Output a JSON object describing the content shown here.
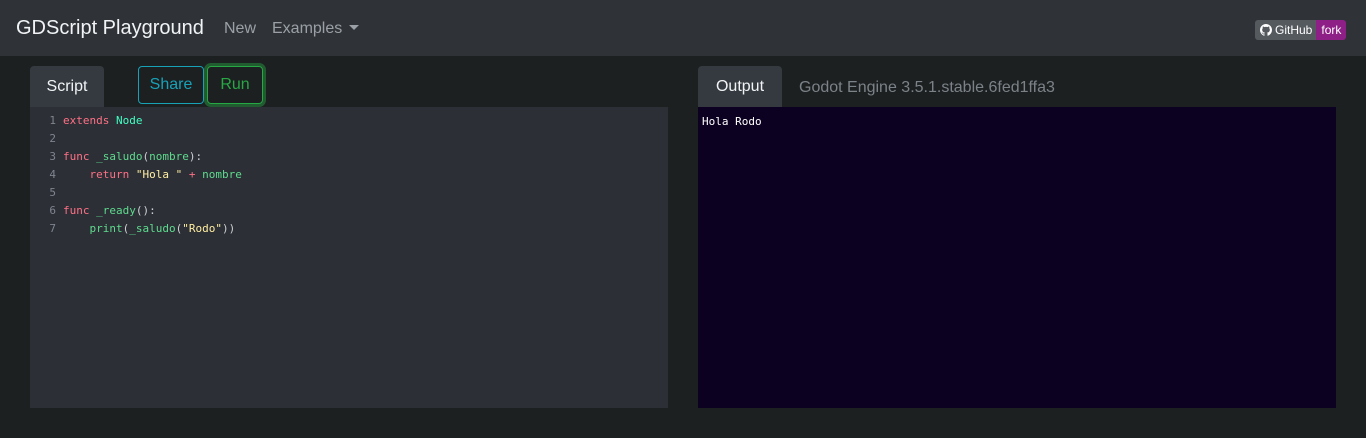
{
  "navbar": {
    "brand": "GDScript Playground",
    "new_label": "New",
    "examples_label": "Examples",
    "github_label": "GitHub",
    "fork_label": "fork",
    "fork_color": "#8e1f86"
  },
  "script_panel": {
    "tab_label": "Script",
    "share_label": "Share",
    "run_label": "Run",
    "lines": [
      {
        "num": "1",
        "tokens": [
          {
            "t": "extends",
            "c": "kw"
          },
          {
            "t": " ",
            "c": "pl"
          },
          {
            "t": "Node",
            "c": "cls"
          }
        ]
      },
      {
        "num": "2",
        "tokens": []
      },
      {
        "num": "3",
        "tokens": [
          {
            "t": "func",
            "c": "kw"
          },
          {
            "t": " ",
            "c": "pl"
          },
          {
            "t": "_saludo",
            "c": "fn2"
          },
          {
            "t": "(",
            "c": "pl"
          },
          {
            "t": "nombre",
            "c": "fn2"
          },
          {
            "t": "):",
            "c": "pl"
          }
        ]
      },
      {
        "num": "4",
        "tokens": [
          {
            "t": "    ",
            "c": "pl"
          },
          {
            "t": "return",
            "c": "kw"
          },
          {
            "t": " ",
            "c": "pl"
          },
          {
            "t": "\"Hola \"",
            "c": "str"
          },
          {
            "t": " + ",
            "c": "kw"
          },
          {
            "t": "nombre",
            "c": "fn2"
          }
        ]
      },
      {
        "num": "5",
        "tokens": []
      },
      {
        "num": "6",
        "tokens": [
          {
            "t": "func",
            "c": "kw"
          },
          {
            "t": " ",
            "c": "pl"
          },
          {
            "t": "_ready",
            "c": "fn2"
          },
          {
            "t": "():",
            "c": "pl"
          }
        ]
      },
      {
        "num": "7",
        "tokens": [
          {
            "t": "    ",
            "c": "pl"
          },
          {
            "t": "print",
            "c": "fn2"
          },
          {
            "t": "(",
            "c": "pl"
          },
          {
            "t": "_saludo",
            "c": "fn2"
          },
          {
            "t": "(",
            "c": "pl"
          },
          {
            "t": "\"Rodo\"",
            "c": "str"
          },
          {
            "t": "))",
            "c": "pl"
          }
        ]
      }
    ]
  },
  "output_panel": {
    "tab_label": "Output",
    "version": "Godot Engine 3.5.1.stable.6fed1ffa3",
    "text": "Hola Rodo"
  }
}
